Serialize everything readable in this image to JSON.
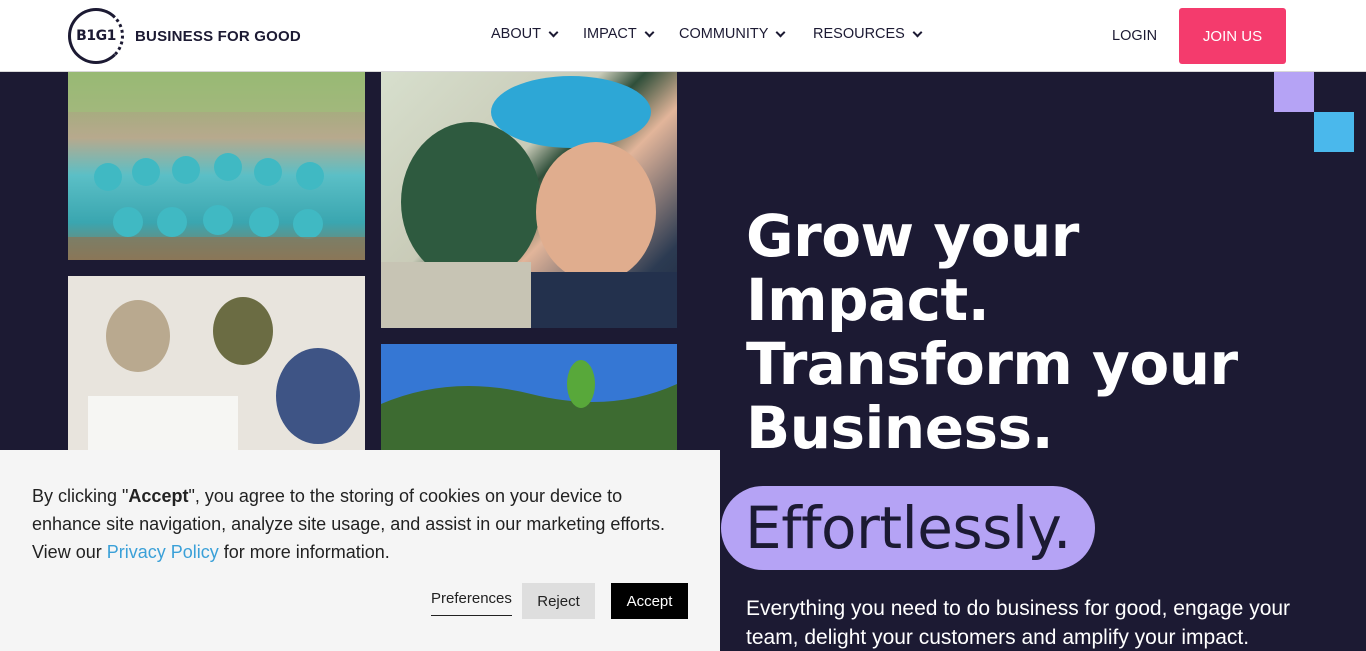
{
  "header": {
    "logo_mark": "B1G1",
    "logo_text": "BUSINESS FOR GOOD",
    "nav": [
      {
        "label": "ABOUT"
      },
      {
        "label": "IMPACT"
      },
      {
        "label": "COMMUNITY"
      },
      {
        "label": "RESOURCES"
      }
    ],
    "login_label": "LOGIN",
    "join_label": "JOIN US"
  },
  "hero": {
    "title_lines": [
      "Grow your",
      "Impact.",
      "Transform your",
      "Business."
    ],
    "highlight": "Effortlessly.",
    "subtitle": "Everything you need to do business for good, engage your team, delight your customers and amplify your impact."
  },
  "cookie": {
    "text_before": "By clicking \"",
    "text_bold": "Accept",
    "text_after": "\", you agree to the storing of cookies on your device to enhance site navigation, analyze site usage, and assist in our marketing efforts. View our ",
    "link_label": "Privacy Policy",
    "text_end": " for more information.",
    "preferences_label": "Preferences",
    "reject_label": "Reject",
    "accept_label": "Accept"
  },
  "colors": {
    "navy": "#1c1a33",
    "pink": "#f43b6d",
    "lavender": "#b5a3f5",
    "sky": "#4ab8ec"
  }
}
